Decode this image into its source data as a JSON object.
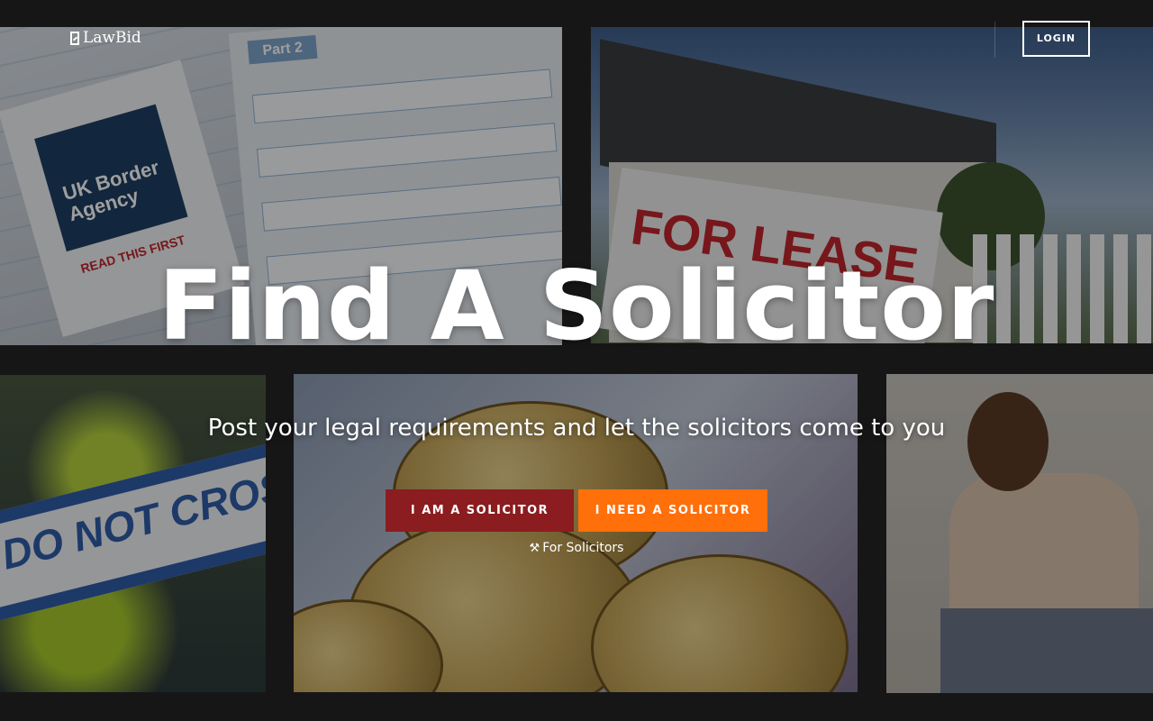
{
  "brand": {
    "logo_text": "LawBid",
    "icon": "lawbid-logo-icon"
  },
  "nav": {
    "login_label": "LOGIN"
  },
  "hero": {
    "title": "Find A Solicitor",
    "subtitle": "Post your legal requirements and let the solicitors come to you"
  },
  "buttons": {
    "solicitor_label": "I AM A SOLICITOR",
    "need_label": "I NEED A SOLICITOR",
    "for_solicitors_label": "For Solicitors",
    "for_solicitors_icon": "gavel-icon"
  },
  "background_tiles": {
    "form": {
      "part_label": "Part 2",
      "badge_text": "UK Border Agency",
      "warning_text": "READ THIS FIRST"
    },
    "house": {
      "sign_text": "FOR LEASE"
    },
    "tape": {
      "tape_text": "DO NOT CROSS"
    }
  },
  "colors": {
    "background": "#161616",
    "solicitor_button": "#8b1c20",
    "need_button": "#ff6f0a",
    "text": "#ffffff"
  }
}
